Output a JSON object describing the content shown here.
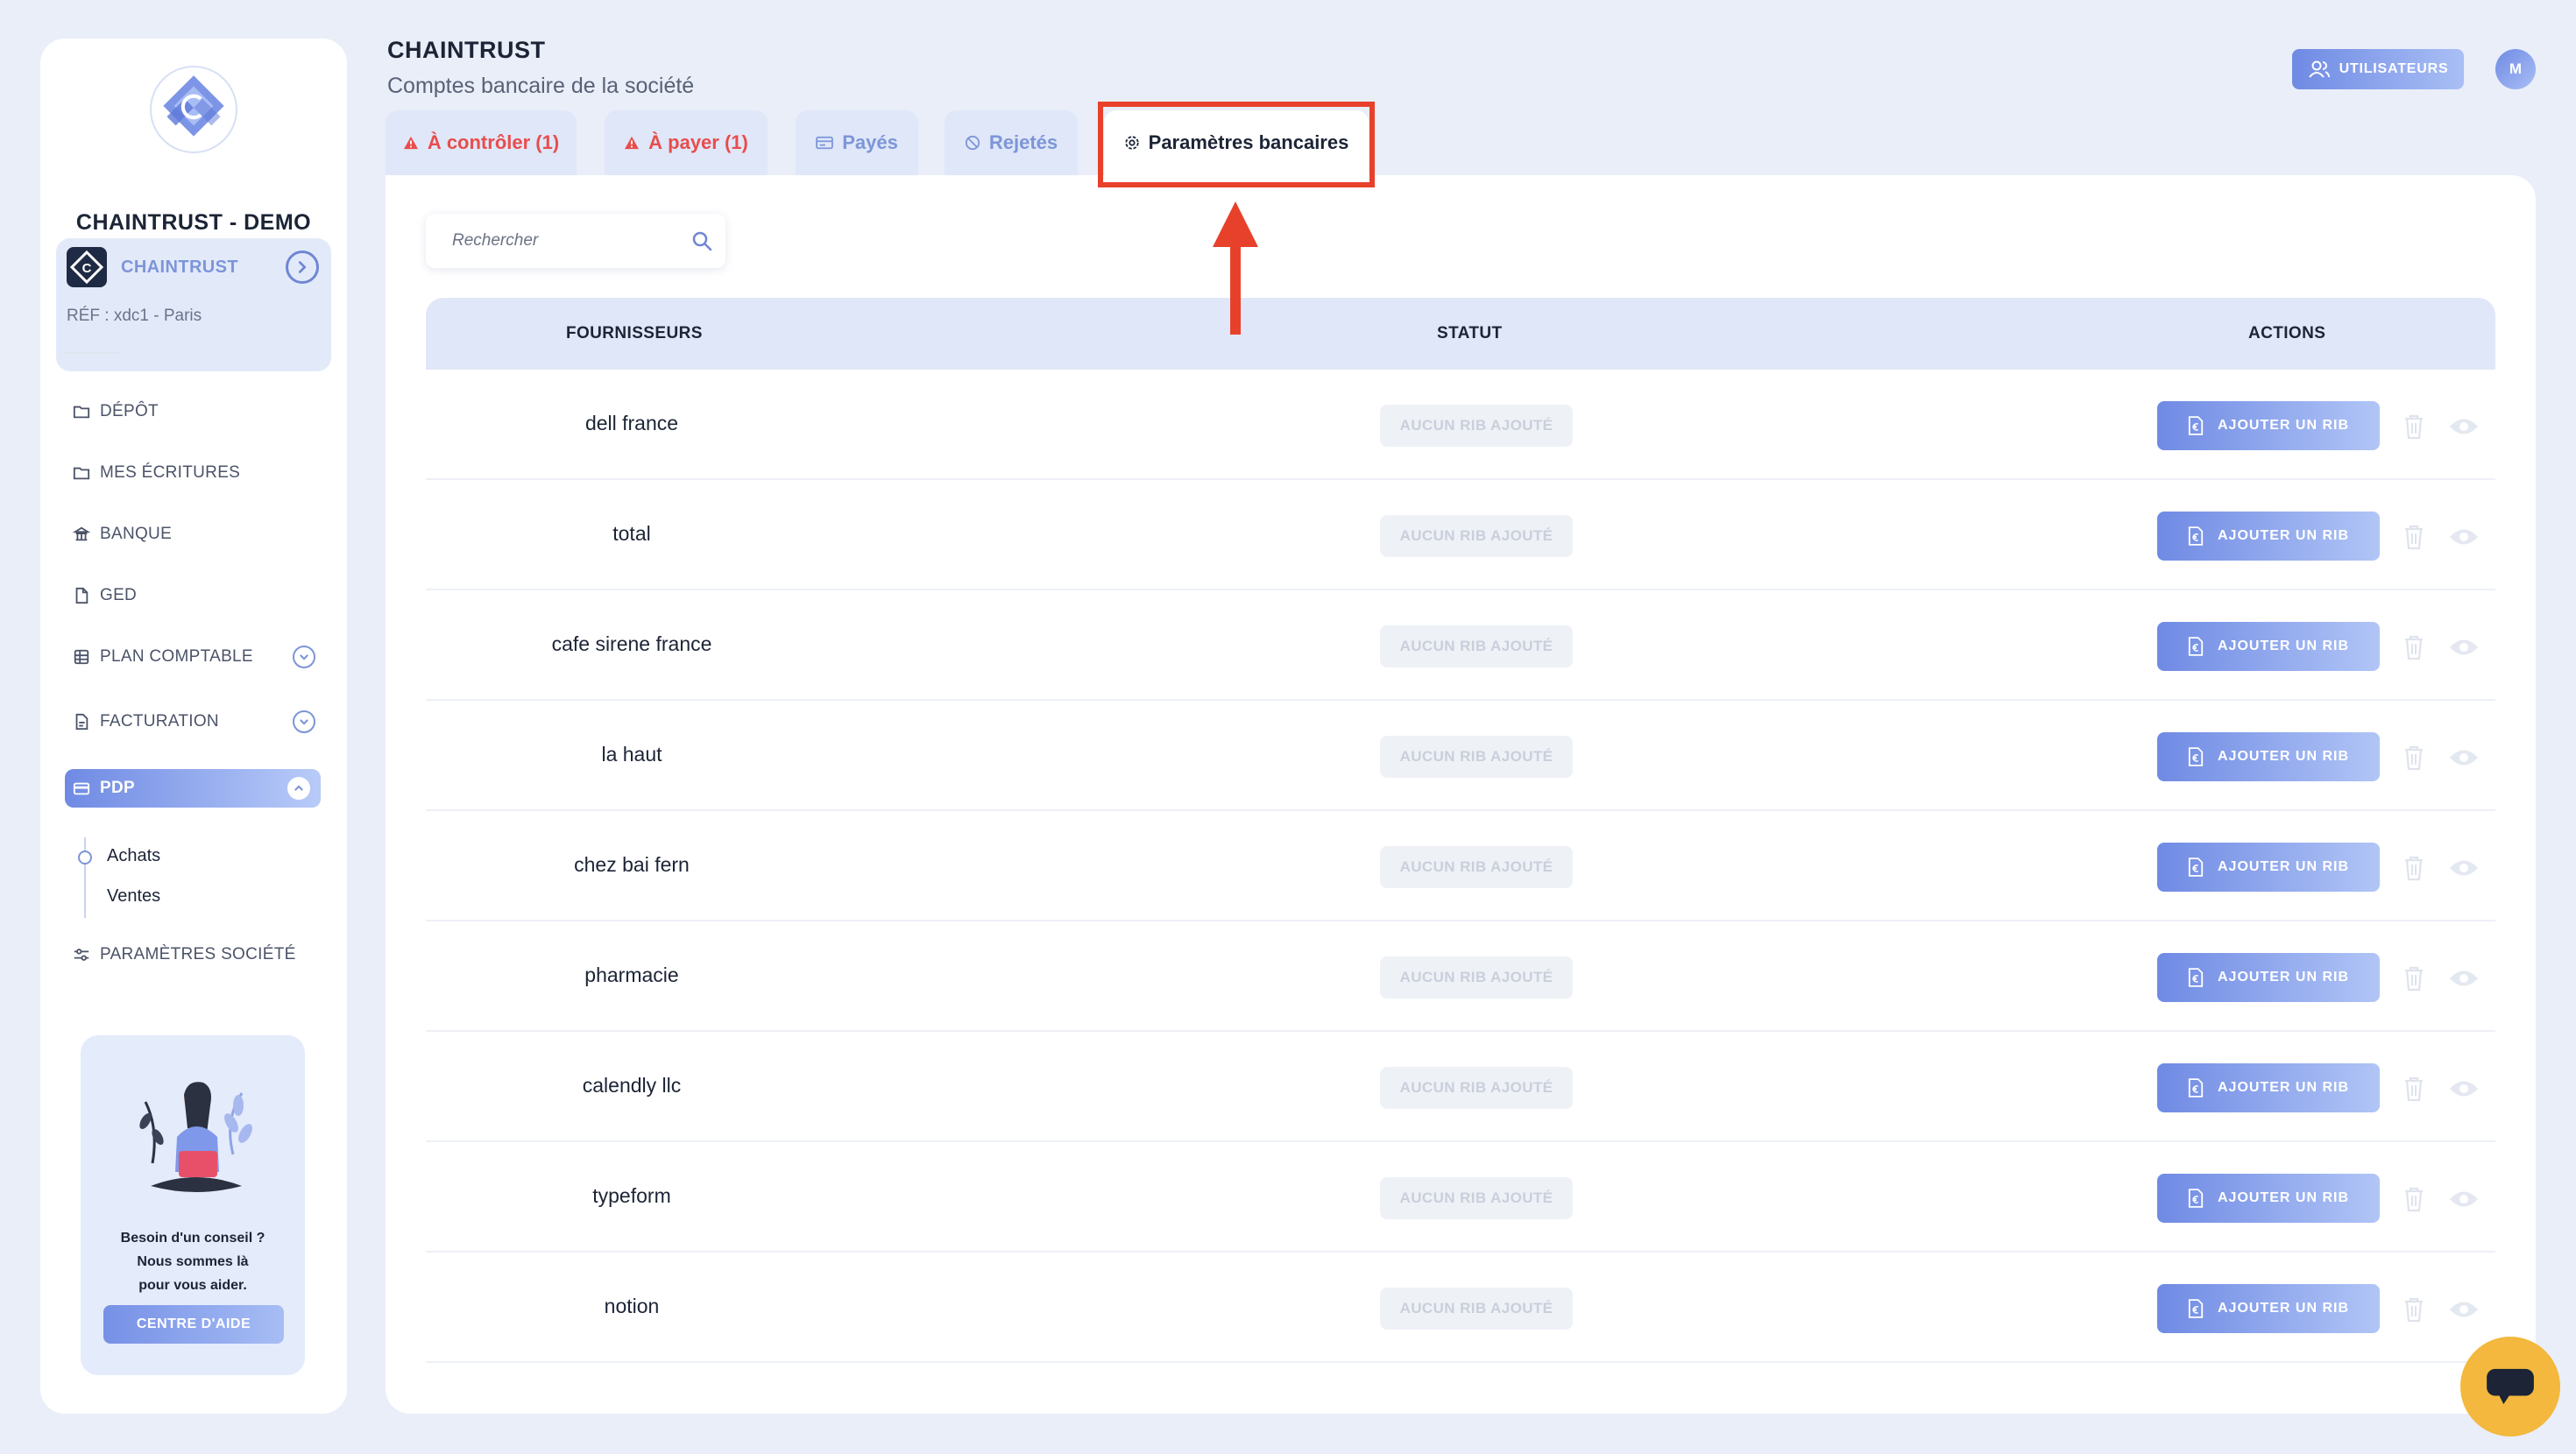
{
  "sidebar": {
    "company_name": "CHAINTRUST - DEMO",
    "company_card": {
      "name": "CHAINTRUST",
      "ref": "RÉF : xdc1 - Paris"
    },
    "nav": [
      {
        "label": "DÉPÔT",
        "icon": "folder-icon"
      },
      {
        "label": "MES ÉCRITURES",
        "icon": "folder-icon"
      },
      {
        "label": "BANQUE",
        "icon": "bank-icon"
      },
      {
        "label": "GED",
        "icon": "file-icon"
      },
      {
        "label": "PLAN COMPTABLE",
        "icon": "ledger-icon"
      },
      {
        "label": "FACTURATION",
        "icon": "invoice-icon"
      },
      {
        "label": "PDP",
        "icon": "card-icon"
      },
      {
        "label": "PARAMÈTRES SOCIÉTÉ",
        "icon": "sliders-icon"
      }
    ],
    "pdp_sub": [
      "Achats",
      "Ventes"
    ],
    "help": {
      "line1": "Besoin d'un conseil ?",
      "line2": "Nous sommes là",
      "line3": "pour vous aider.",
      "button": "CENTRE D'AIDE"
    }
  },
  "header": {
    "title": "CHAINTRUST",
    "subtitle": "Comptes bancaire de la société",
    "users_button": "UTILISATEURS",
    "avatar_initial": "M"
  },
  "tabs": [
    {
      "label": "À contrôler (1)",
      "icon": "warning-icon"
    },
    {
      "label": "À payer (1)",
      "icon": "warning-icon"
    },
    {
      "label": "Payés",
      "icon": "payment-icon"
    },
    {
      "label": "Rejetés",
      "icon": "forbidden-icon"
    },
    {
      "label": "Paramètres bancaires",
      "icon": "gear-icon"
    }
  ],
  "search": {
    "placeholder": "Rechercher"
  },
  "table": {
    "headers": {
      "suppliers": "FOURNISSEURS",
      "status": "STATUT",
      "actions": "ACTIONS"
    },
    "status_label": "AUCUN RIB AJOUTÉ",
    "add_button": "AJOUTER UN RIB",
    "rows": [
      "dell france",
      "total",
      "cafe sirene france",
      "la haut",
      "chez bai fern",
      "pharmacie",
      "calendly llc",
      "typeform",
      "notion"
    ]
  },
  "colors": {
    "accent": "#6f8ae4",
    "warning": "#e84d4d",
    "highlight": "#e8412b",
    "chat": "#f3b83d"
  }
}
